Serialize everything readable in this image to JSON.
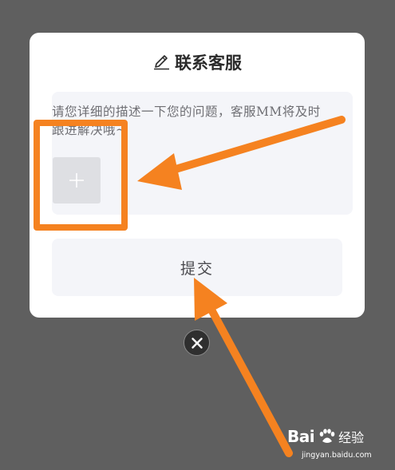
{
  "dialog": {
    "title": "联系客服",
    "description_placeholder": "请您详细的描述一下您的问题，客服MM将及时跟进解决哦~",
    "add_label": "+",
    "submit_label": "提交"
  },
  "colors": {
    "backdrop": "#5f5f5f",
    "dialog_bg": "#ffffff",
    "field_bg": "#f4f5f9",
    "annotation_orange": "#f58220"
  },
  "icons": {
    "title_icon": "pencil-icon",
    "close_icon": "close-icon"
  },
  "watermark": {
    "logo_left": "Bai",
    "logo_right": "经验",
    "url": "jingyan.baidu.com"
  }
}
